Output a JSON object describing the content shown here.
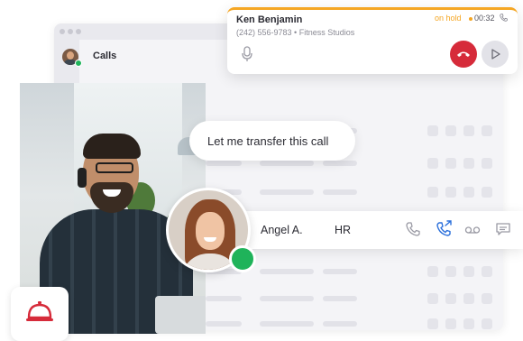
{
  "app": {
    "section_title": "Calls"
  },
  "active_call": {
    "caller_name": "Ken Benjamin",
    "caller_details": "(242) 556-9783 • Fitness Studios",
    "status": "on hold",
    "timer": "00:32",
    "icons": {
      "status": "phone-icon",
      "mic": "microphone-icon",
      "hangup": "hangup-icon",
      "resume": "play-icon"
    },
    "colors": {
      "accent": "#f5a623",
      "hangup": "#d62b3a"
    }
  },
  "chat_bubble": {
    "text": "Let me transfer this call"
  },
  "transfer_contact": {
    "name": "Angel A.",
    "department": "HR",
    "status_color": "#1fb35a",
    "actions": [
      {
        "icon": "phone-icon",
        "highlighted": false
      },
      {
        "icon": "transfer-call-icon",
        "highlighted": true
      },
      {
        "icon": "voicemail-icon",
        "highlighted": false
      },
      {
        "icon": "message-icon",
        "highlighted": false
      }
    ],
    "highlight_color": "#2a6fdb"
  },
  "colors": {
    "online": "#1fb35a",
    "bell": "#d62b3a"
  },
  "decor_icons": [
    "concierge-bell-icon"
  ]
}
